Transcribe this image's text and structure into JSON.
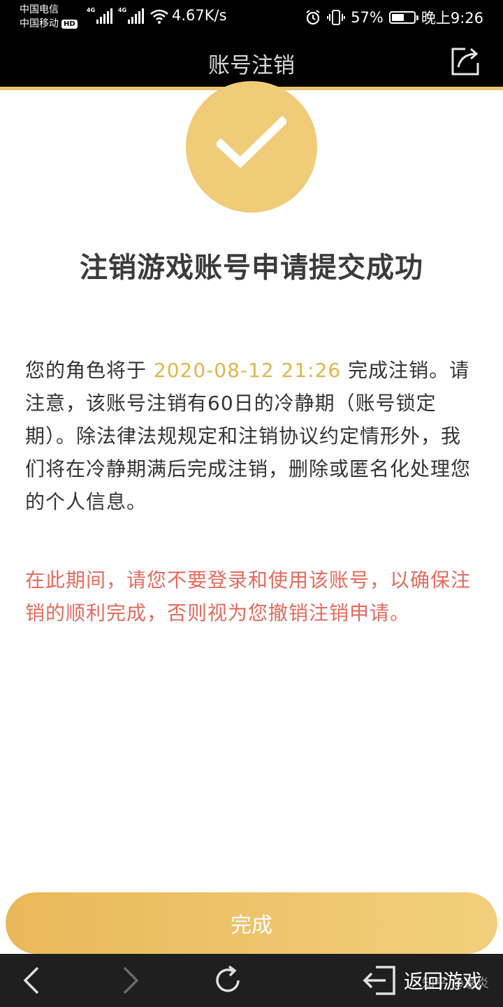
{
  "status_bar": {
    "carrier_1": "中国电信",
    "carrier_2": "中国移动",
    "hd_badge": "HD",
    "network_1": "4G",
    "network_2": "4G",
    "speed": "4.67K/s",
    "battery": "57%",
    "battery_level": 0.57,
    "time": "晚上9:26"
  },
  "title_bar": {
    "title": "账号注销"
  },
  "headline": "注销游戏账号申请提交成功",
  "notice": {
    "prefix": "您的角色将于 ",
    "date": "2020-08-12 21:26",
    "suffix": " 完成注销。请注意，该账号注销有60日的冷静期（账号锁定期）。除法律法规规定和注销协议约定情形外，我们将在冷静期满后完成注销，删除或匿名化处理您的个人信息。"
  },
  "warning": "在此期间，请您不要登录和使用该账号，以确保注销的顺利完成，否则视为您撤销注销申请。",
  "done_button": "完成",
  "bottom_nav": {
    "back_to_game": "返回游戏",
    "watermark": "知乎 @家炎"
  },
  "colors": {
    "accent_gold": "#f0cc78",
    "date_color": "#e0b54c",
    "warning_red": "#e46a5c"
  },
  "icons": {
    "alarm": "alarm-icon",
    "vibrate": "vibrate-icon",
    "wifi": "wifi-icon",
    "share": "share-icon",
    "check": "check-icon",
    "back": "chevron-left-icon",
    "forward": "chevron-right-icon",
    "refresh": "refresh-icon",
    "exit": "exit-icon"
  }
}
